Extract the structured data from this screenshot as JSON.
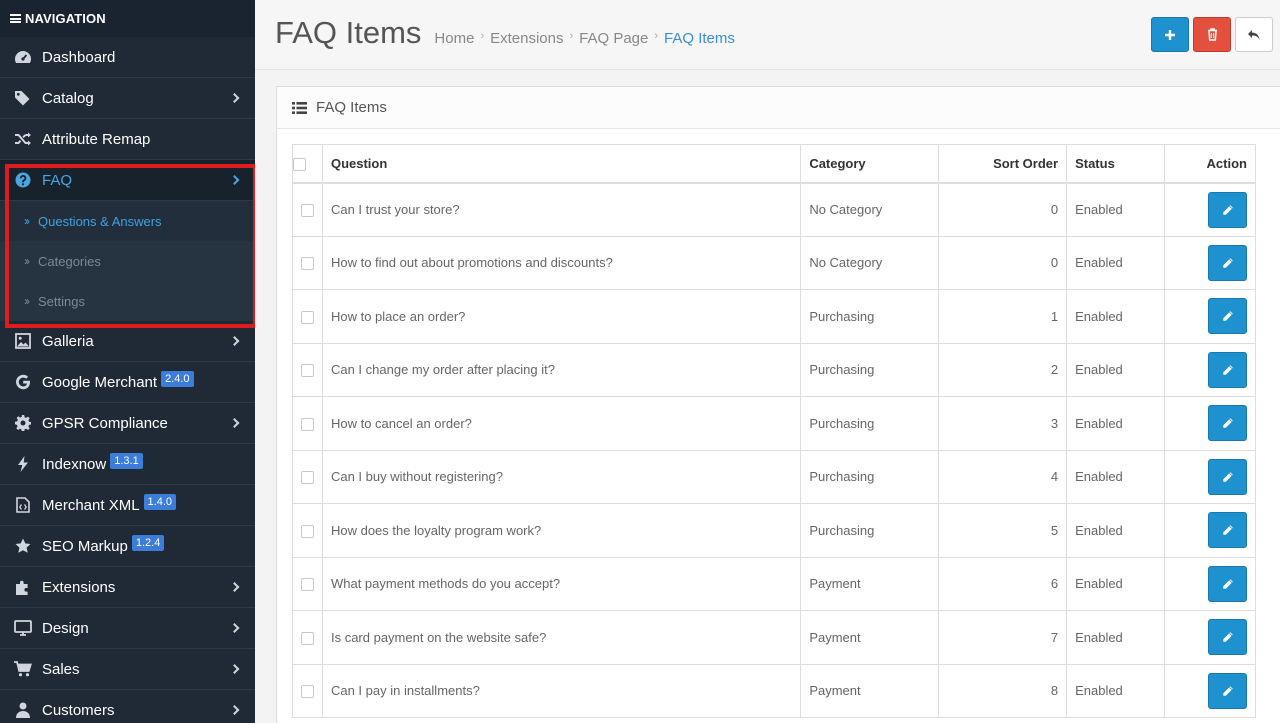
{
  "sidebar": {
    "header": "NAVIGATION",
    "items": [
      {
        "label": "Dashboard",
        "icon": "dashboard-icon"
      },
      {
        "label": "Catalog",
        "icon": "tags-icon",
        "has_children": true
      },
      {
        "label": "Attribute Remap",
        "icon": "shuffle-icon"
      },
      {
        "label": "FAQ",
        "icon": "question-circle-icon",
        "has_children": true,
        "active": true
      },
      {
        "label": "Galleria",
        "icon": "image-icon",
        "has_children": true
      },
      {
        "label": "Google Merchant",
        "icon": "google-icon",
        "badge": "2.4.0"
      },
      {
        "label": "GPSR Compliance",
        "icon": "gear-icon",
        "has_children": true
      },
      {
        "label": "Indexnow",
        "icon": "bolt-icon",
        "badge": "1.3.1"
      },
      {
        "label": "Merchant XML",
        "icon": "code-file-icon",
        "badge": "1.4.0"
      },
      {
        "label": "SEO Markup",
        "icon": "star-icon",
        "badge": "1.2.4"
      },
      {
        "label": "Extensions",
        "icon": "puzzle-icon",
        "has_children": true
      },
      {
        "label": "Design",
        "icon": "monitor-icon",
        "has_children": true
      },
      {
        "label": "Sales",
        "icon": "cart-icon",
        "has_children": true
      },
      {
        "label": "Customers",
        "icon": "user-icon",
        "has_children": true
      }
    ],
    "faq_submenu": [
      {
        "label": "Questions & Answers",
        "current": true
      },
      {
        "label": "Categories"
      },
      {
        "label": "Settings"
      }
    ]
  },
  "header": {
    "title": "FAQ Items",
    "breadcrumb": [
      "Home",
      "Extensions",
      "FAQ Page",
      "FAQ Items"
    ]
  },
  "panel": {
    "title": "FAQ Items"
  },
  "table": {
    "headers": {
      "question": "Question",
      "category": "Category",
      "sort_order": "Sort Order",
      "status": "Status",
      "action": "Action"
    },
    "rows": [
      {
        "question": "Can I trust your store?",
        "category": "No Category",
        "sort_order": "0",
        "status": "Enabled"
      },
      {
        "question": "How to find out about promotions and discounts?",
        "category": "No Category",
        "sort_order": "0",
        "status": "Enabled"
      },
      {
        "question": "How to place an order?",
        "category": "Purchasing",
        "sort_order": "1",
        "status": "Enabled"
      },
      {
        "question": "Can I change my order after placing it?",
        "category": "Purchasing",
        "sort_order": "2",
        "status": "Enabled"
      },
      {
        "question": "How to cancel an order?",
        "category": "Purchasing",
        "sort_order": "3",
        "status": "Enabled"
      },
      {
        "question": "Can I buy without registering?",
        "category": "Purchasing",
        "sort_order": "4",
        "status": "Enabled"
      },
      {
        "question": "How does the loyalty program work?",
        "category": "Purchasing",
        "sort_order": "5",
        "status": "Enabled"
      },
      {
        "question": "What payment methods do you accept?",
        "category": "Payment",
        "sort_order": "6",
        "status": "Enabled"
      },
      {
        "question": "Is card payment on the website safe?",
        "category": "Payment",
        "sort_order": "7",
        "status": "Enabled"
      },
      {
        "question": "Can I pay in installments?",
        "category": "Payment",
        "sort_order": "8",
        "status": "Enabled"
      }
    ]
  },
  "colors": {
    "sidebar_bg": "#1f2a36",
    "primary": "#1e91cf",
    "danger": "#e3503e",
    "highlight": "#e01b1b",
    "active_link": "#3ea2e0"
  }
}
